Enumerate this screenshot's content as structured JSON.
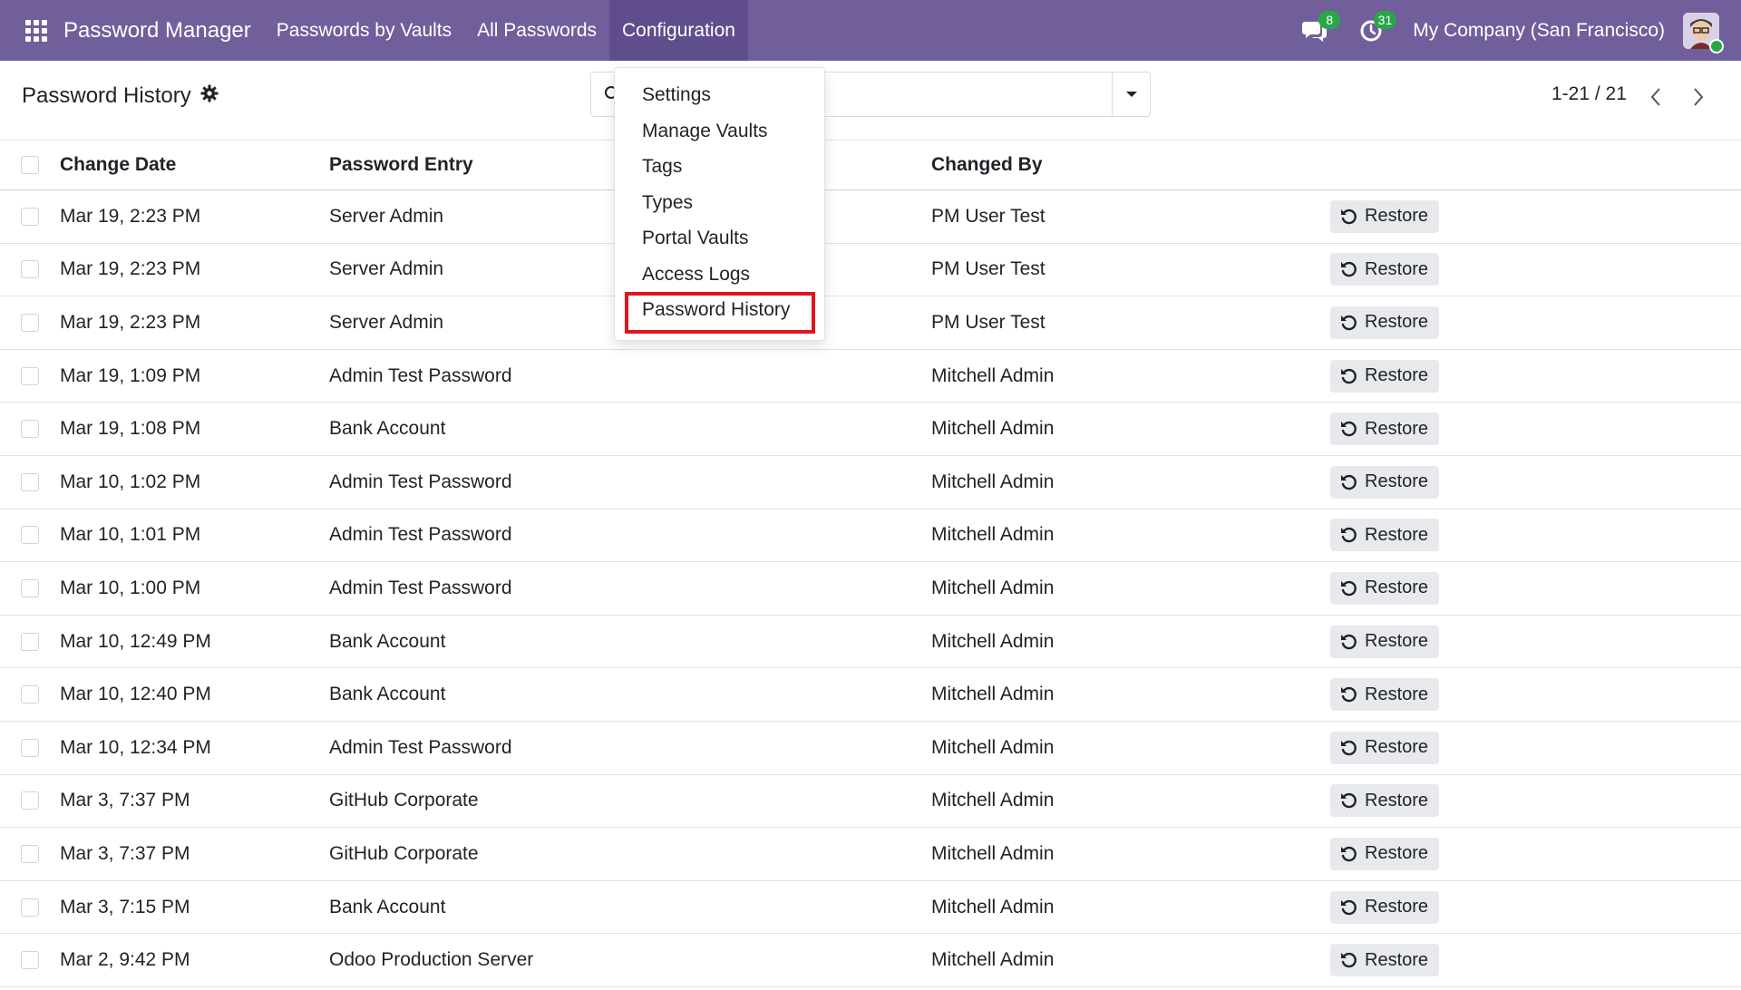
{
  "navbar": {
    "app_title": "Password Manager",
    "menu": [
      {
        "label": "Passwords by Vaults"
      },
      {
        "label": "All Passwords"
      },
      {
        "label": "Configuration"
      }
    ],
    "messages_count": "8",
    "activities_count": "31",
    "company": "My Company (San Francisco)",
    "accent_color": "#715f9c",
    "icons": [
      "apps-grid-icon",
      "chat-icon",
      "clock-icon",
      "user-avatar"
    ]
  },
  "control_panel": {
    "title": "Password History",
    "search_placeholder": "",
    "pager": "1-21 / 21"
  },
  "config_menu": {
    "items": [
      {
        "label": "Settings"
      },
      {
        "label": "Manage Vaults"
      },
      {
        "label": "Tags"
      },
      {
        "label": "Types"
      },
      {
        "label": "Portal Vaults"
      },
      {
        "label": "Access Logs"
      },
      {
        "label": "Password History"
      }
    ],
    "highlighted": "Password History",
    "highlight_color": "#e3141c"
  },
  "table": {
    "columns": [
      "Change Date",
      "Password Entry",
      "Changed By"
    ],
    "restore_label": "Restore",
    "rows": [
      {
        "date": "Mar 19, 2:23 PM",
        "entry": "Server Admin",
        "by": "PM User Test"
      },
      {
        "date": "Mar 19, 2:23 PM",
        "entry": "Server Admin",
        "by": "PM User Test"
      },
      {
        "date": "Mar 19, 2:23 PM",
        "entry": "Server Admin",
        "by": "PM User Test"
      },
      {
        "date": "Mar 19, 1:09 PM",
        "entry": "Admin Test Password",
        "by": "Mitchell Admin"
      },
      {
        "date": "Mar 19, 1:08 PM",
        "entry": "Bank Account",
        "by": "Mitchell Admin"
      },
      {
        "date": "Mar 10, 1:02 PM",
        "entry": "Admin Test Password",
        "by": "Mitchell Admin"
      },
      {
        "date": "Mar 10, 1:01 PM",
        "entry": "Admin Test Password",
        "by": "Mitchell Admin"
      },
      {
        "date": "Mar 10, 1:00 PM",
        "entry": "Admin Test Password",
        "by": "Mitchell Admin"
      },
      {
        "date": "Mar 10, 12:49 PM",
        "entry": "Bank Account",
        "by": "Mitchell Admin"
      },
      {
        "date": "Mar 10, 12:40 PM",
        "entry": "Bank Account",
        "by": "Mitchell Admin"
      },
      {
        "date": "Mar 10, 12:34 PM",
        "entry": "Admin Test Password",
        "by": "Mitchell Admin"
      },
      {
        "date": "Mar 3, 7:37 PM",
        "entry": "GitHub Corporate",
        "by": "Mitchell Admin"
      },
      {
        "date": "Mar 3, 7:37 PM",
        "entry": "GitHub Corporate",
        "by": "Mitchell Admin"
      },
      {
        "date": "Mar 3, 7:15 PM",
        "entry": "Bank Account",
        "by": "Mitchell Admin"
      },
      {
        "date": "Mar 2, 9:42 PM",
        "entry": "Odoo Production Server",
        "by": "Mitchell Admin"
      }
    ]
  }
}
